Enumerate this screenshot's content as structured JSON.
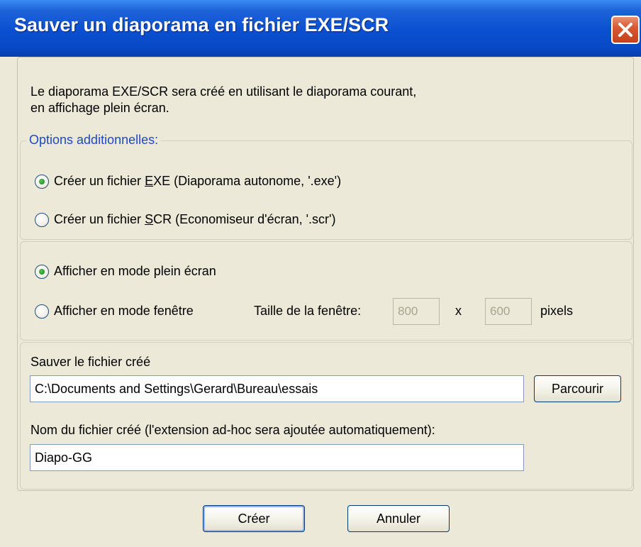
{
  "window": {
    "title": "Sauver un diaporama en fichier EXE/SCR"
  },
  "description": {
    "line1": "Le diaporama EXE/SCR sera créé en utilisant le diaporama courant,",
    "line2": "en affichage plein écran."
  },
  "options": {
    "legend": "Options additionnelles:",
    "exe": {
      "pre": "Créer un fichier ",
      "mnemonic": "E",
      "post": "XE (Diaporama autonome, '.exe')",
      "checked": true
    },
    "scr": {
      "pre": "Créer un fichier ",
      "mnemonic": "S",
      "post": "CR (Economiseur d'écran, '.scr')",
      "checked": false
    }
  },
  "display": {
    "fullscreen_label": "Afficher en mode plein écran",
    "fullscreen_checked": true,
    "window_label": "Afficher en mode fenêtre",
    "window_checked": false,
    "size_label": "Taille de la fenêtre:",
    "width_value": "800",
    "times": "x",
    "height_value": "600",
    "unit": "pixels"
  },
  "save": {
    "path_label": "Sauver le fichier créé",
    "path_value": "C:\\Documents and Settings\\Gerard\\Bureau\\essais",
    "browse_label": "Parcourir",
    "name_label": "Nom du fichier créé (l'extension ad-hoc sera ajoutée automatiquement):",
    "name_value": "Diapo-GG"
  },
  "buttons": {
    "create": "Créer",
    "cancel": "Annuler"
  },
  "icons": {
    "close": "close-icon"
  },
  "colors": {
    "titlebar": "#0A4FD0",
    "close": "#D65A33",
    "legend": "#1E48C8",
    "face": "#ECE9D8"
  }
}
